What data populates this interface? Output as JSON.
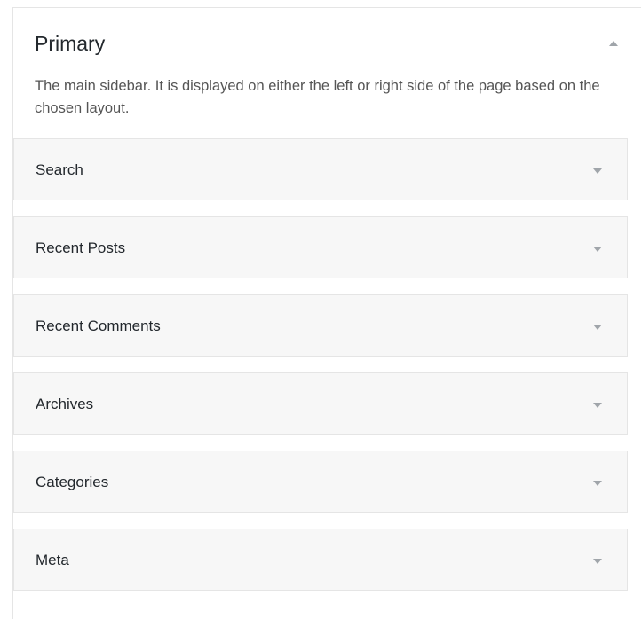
{
  "panel": {
    "title": "Primary",
    "description": "The main sidebar. It is displayed on either the left or right side of the page based on the chosen layout.",
    "toggle_icon": "triangle-up-icon"
  },
  "widgets": [
    {
      "label": "Search",
      "icon": "triangle-down-icon"
    },
    {
      "label": "Recent Posts",
      "icon": "triangle-down-icon"
    },
    {
      "label": "Recent Comments",
      "icon": "triangle-down-icon"
    },
    {
      "label": "Archives",
      "icon": "triangle-down-icon"
    },
    {
      "label": "Categories",
      "icon": "triangle-down-icon"
    },
    {
      "label": "Meta",
      "icon": "triangle-down-icon"
    }
  ],
  "colors": {
    "arrow": "#a0a5aa",
    "widget_bg": "#f7f7f7",
    "border": "#e5e5e5"
  }
}
